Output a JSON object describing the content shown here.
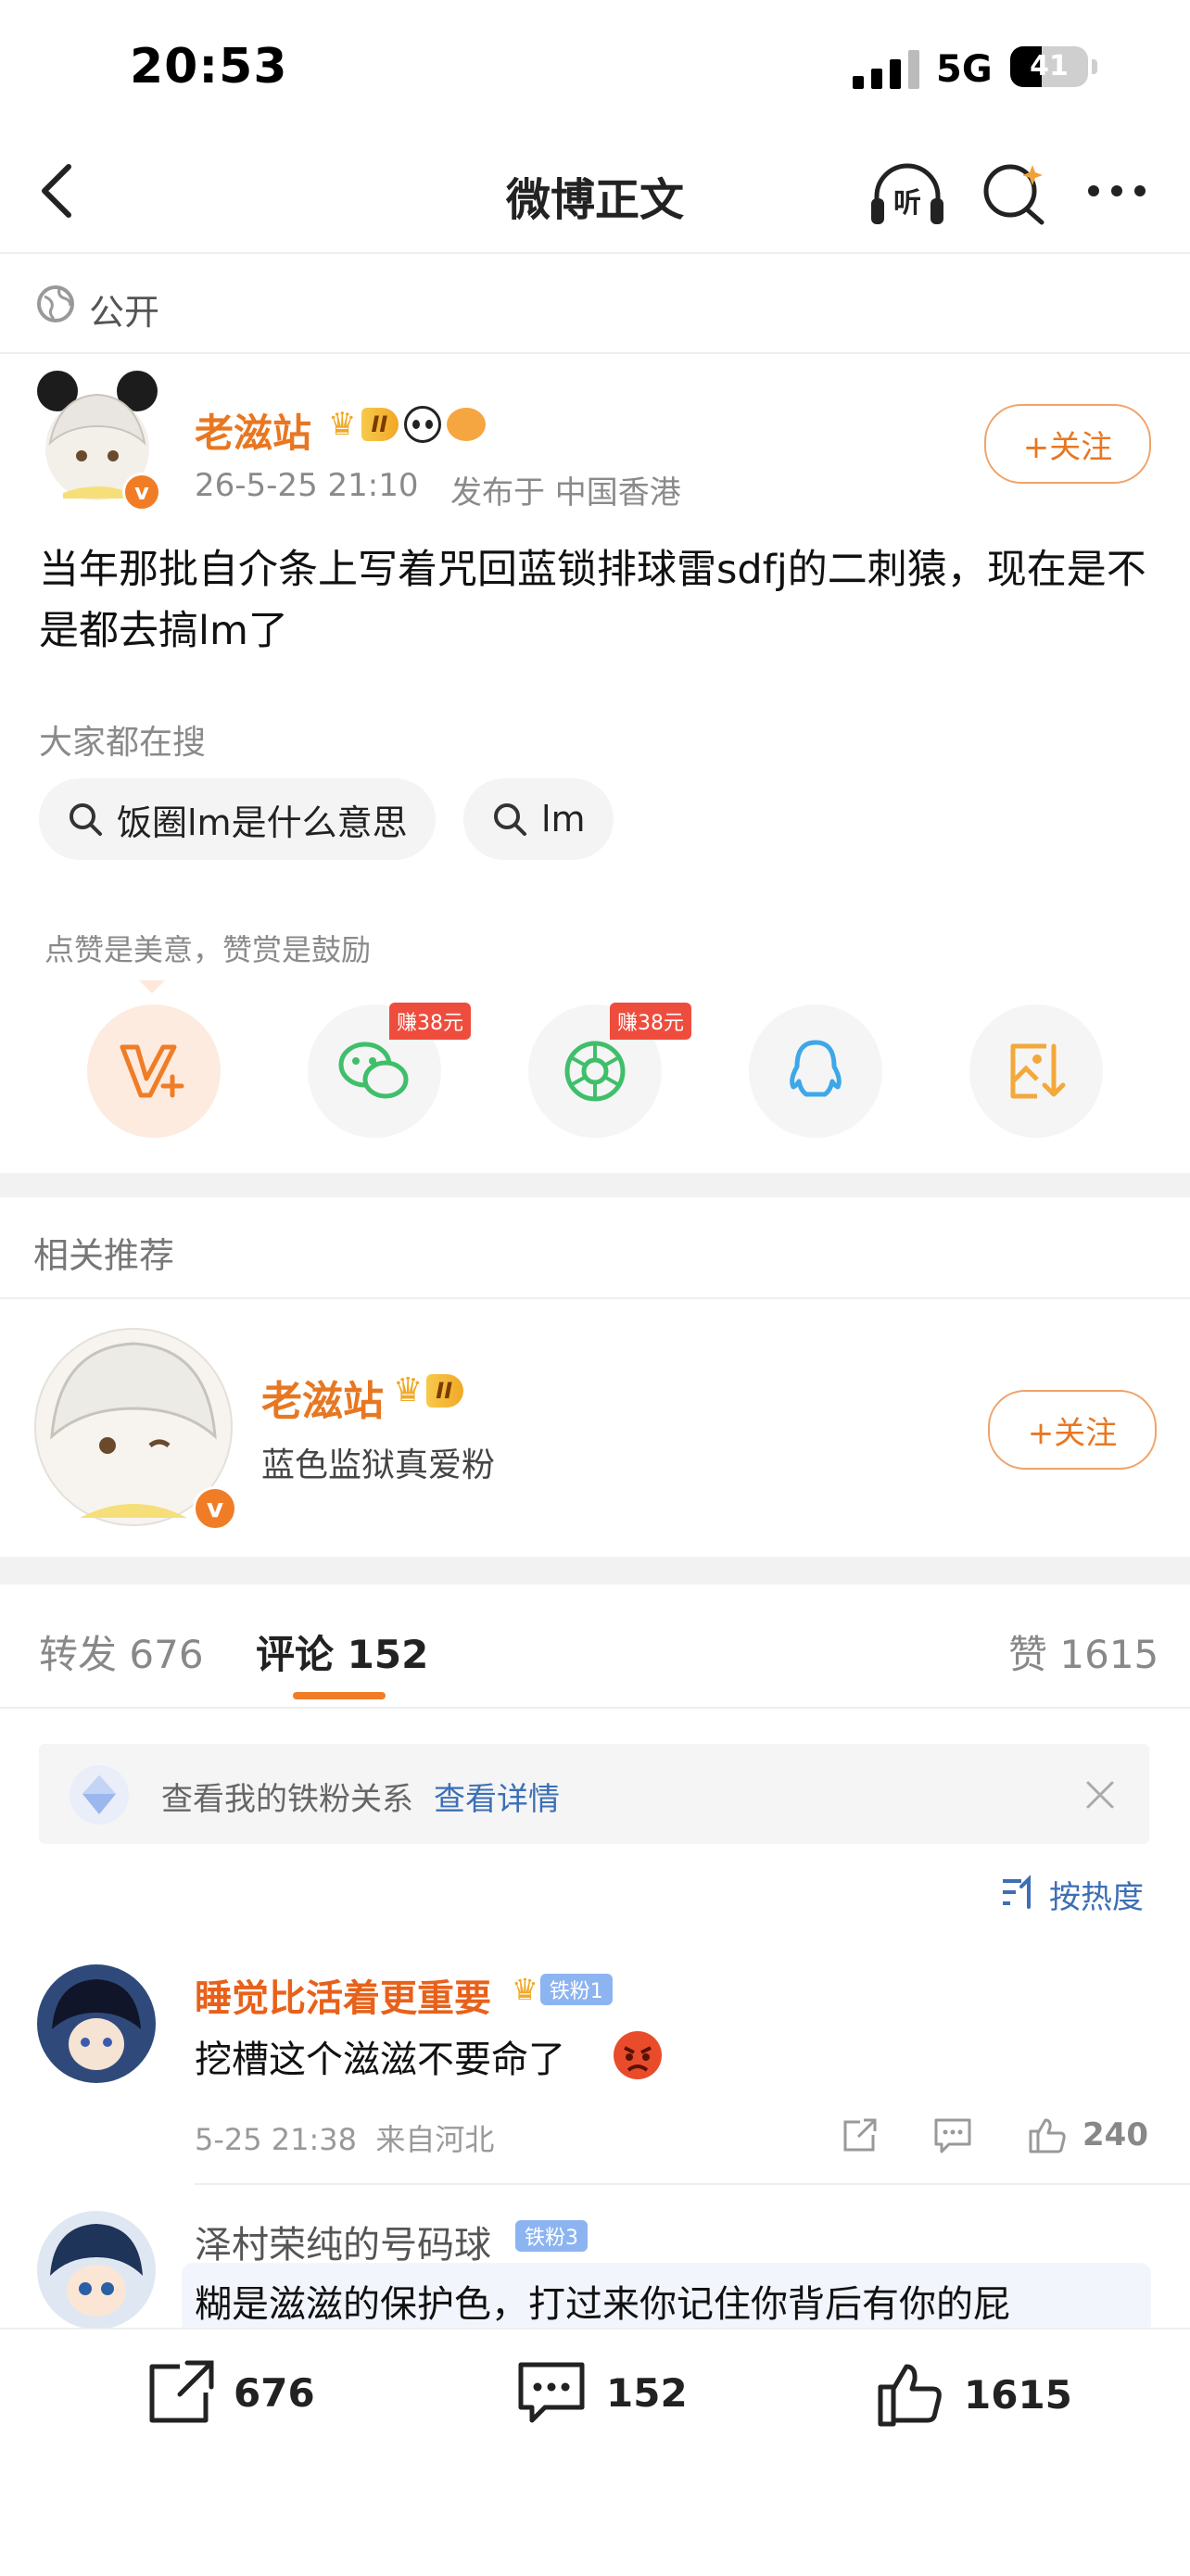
{
  "status_bar": {
    "time": "20:53",
    "network": "5G",
    "battery": "41",
    "battery_level": 0.41
  },
  "nav": {
    "title": "微博正文",
    "listen_label": "听"
  },
  "visibility": {
    "label": "公开"
  },
  "post": {
    "author": "老滋站",
    "level_badge": "II",
    "timestamp": "26-5-25 21:10",
    "location": "发布于 中国香港",
    "follow_label": "+关注",
    "content": "当年那批自介条上写着咒回蓝锁排球雷sdfj的二刺猿，现在是不是都去搞lm了"
  },
  "search_section": {
    "title": "大家都在搜",
    "chips": [
      "饭圈lm是什么意思",
      "lm"
    ]
  },
  "reward": {
    "tip": "点赞是美意，赞赏是鼓励",
    "earn_tag_1": "赚38元",
    "earn_tag_2": "赚38元"
  },
  "related": {
    "title": "相关推荐",
    "name": "老滋站",
    "level_badge": "II",
    "desc": "蓝色监狱真爱粉",
    "follow_label": "+关注"
  },
  "tabs": {
    "repost_label": "转发",
    "repost_count": "676",
    "comment_label": "评论",
    "comment_count": "152",
    "like_label": "赞",
    "like_count": "1615"
  },
  "fan_banner": {
    "text": "查看我的铁粉关系",
    "link": "查看详情"
  },
  "sort": {
    "label": "按热度"
  },
  "comments": [
    {
      "user": "睡觉比活着更重要",
      "badge": "铁粉1",
      "text": "挖槽这个滋滋不要命了",
      "meta": "5-25 21:38  来自河北",
      "likes": "240"
    },
    {
      "user": "泽村荣纯的号码球",
      "badge": "铁粉3",
      "text": "糊是滋滋的保护色，打过来你记住你背后有你的屁"
    }
  ],
  "bottom_bar": {
    "repost": "676",
    "comment": "152",
    "like": "1615"
  },
  "colors": {
    "accent": "#e87722",
    "link": "#3d6fb5",
    "earn": "#ee4d3d"
  }
}
